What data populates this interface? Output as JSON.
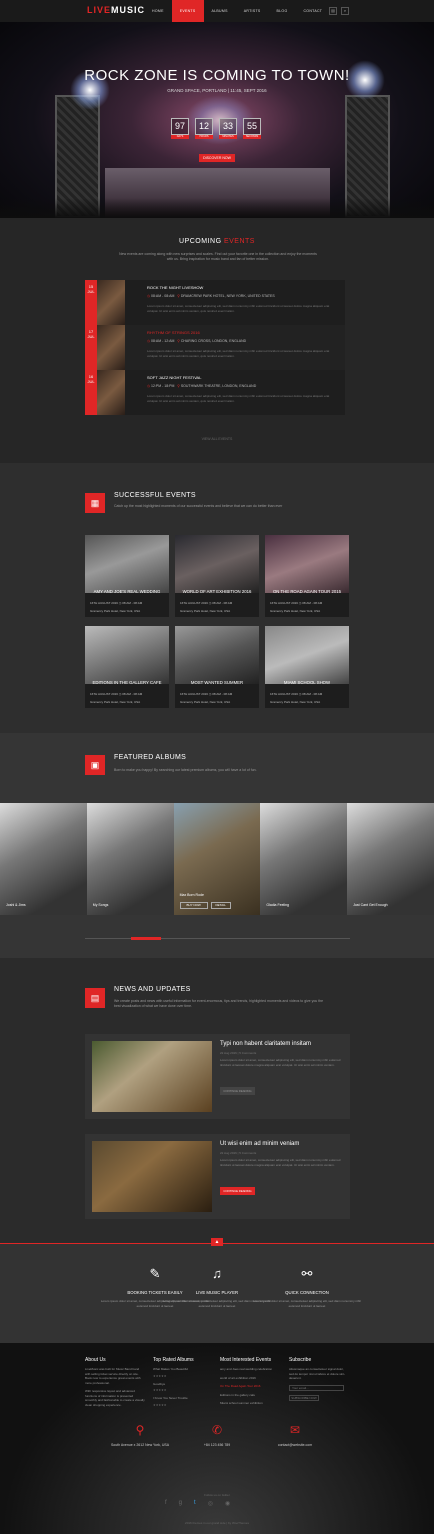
{
  "brand": {
    "logo_a": "LIVE",
    "logo_b": "MUSIC",
    "accent": "#e02626"
  },
  "nav": {
    "items": [
      "HOME",
      "EVENTS",
      "ALBUMS",
      "ARTISTS",
      "BLOG",
      "CONTACT"
    ],
    "active": 1
  },
  "hero": {
    "title": "ROCK ZONE IS COMING TO TOWN!",
    "subtitle": "GRAND SPACE, PORTLAND  |  11:45, SEPT 2016",
    "countdown": [
      {
        "n": "97",
        "l": "DAYS"
      },
      {
        "n": "12",
        "l": "HOURS"
      },
      {
        "n": "33",
        "l": "MINUTES"
      },
      {
        "n": "55",
        "l": "SECONDS"
      }
    ],
    "cta": "DISCOVER NOW"
  },
  "upcoming": {
    "title_a": "UPCOMING",
    "title_b": "EVENTS",
    "desc": "New events are coming along with new surprises and scales. Find out your favorite one in the collection and enjoy the moments with us. Bring inspiration for music band and fan of better mission.",
    "events": [
      {
        "day": "15",
        "mon": "JUL",
        "title": "ROCK THE NIGHT LIVESHOW",
        "time": "08:AM - 08:AM",
        "place": "DRAMCREW PARK HOTEL, NEW YORK, UNITED STATES",
        "red": false
      },
      {
        "day": "17",
        "mon": "JUL",
        "title": "RHYTHM OF STRINGS 2016",
        "time": "08:AM - 12:AM",
        "place": "CHARING CROSS, LONDON, ENGLAND",
        "red": true
      },
      {
        "day": "16",
        "mon": "JUL",
        "title": "SOFT JAZZ NIGHT FESTIVAL",
        "time": "12:PM - 18:PM",
        "place": "SOUTHWARK THEATRE, LONDON, ENGLAND",
        "red": false
      }
    ],
    "text": "Lorem ipsum dolor sit amet, consectetuer adipiscing elit, sed diam nonummy nibh euismod tincidunt ut laoreet dolore magna aliquam erat volutpat. Ut wisi enim ad minim veniam, quis nostrud exerci tation.",
    "more": "VIEW ALL EVENTS"
  },
  "success": {
    "title": "SUCCESSFUL EVENTS",
    "desc": "Catch up the most highlighted moments of our successful events and believe that we can do better than ever",
    "cards": [
      {
        "t": "AMY AND JOE'S REAL WEDDING",
        "d": "16TH AUGUST 2016",
        "h": "08:AM - 08:AM",
        "l": "Gramercy Park Hotel, New York, USA"
      },
      {
        "t": "WORLD OF ART EXHIBITION 2016",
        "d": "16TH AUGUST 2016",
        "h": "08:AM - 08:AM",
        "l": "Gramercy Park Hotel, New York, USA"
      },
      {
        "t": "ON THE ROAD AGAIN TOUR 2015",
        "d": "16TH AUGUST 2016",
        "h": "08:AM - 08:AM",
        "l": "Gramercy Park Hotel, New York, USA"
      },
      {
        "t": "EDITIONS IN THE GALLERY CAFE",
        "d": "16TH AUGUST 2016",
        "h": "08:AM - 08:AM",
        "l": "Gramercy Park Hotel, New York, USA"
      },
      {
        "t": "MOST WANTED SUMMER",
        "d": "16TH AUGUST 2016",
        "h": "08:AM - 08:AM",
        "l": "Gramercy Park Hotel, New York, USA"
      },
      {
        "t": "MIAMI SCHOOL SHOW",
        "d": "16TH AUGUST 2016",
        "h": "08:AM - 08:AM",
        "l": "Gramercy Park Hotel, New York, USA"
      }
    ]
  },
  "albums": {
    "title": "FEATURED ALBUMS",
    "desc": "Born to make you happy! By searching our latest premium albums, you will have a lot of fun.",
    "items": [
      "Joshi & Jims",
      "My Songs",
      "Max Born Rode",
      "Gladia Feeling",
      "Just Cant Get Enough"
    ],
    "buy": "BUY NOW",
    "detail": "DETAIL"
  },
  "news": {
    "title": "NEWS AND UPDATES",
    "desc": "We create posts and news with useful information for event-enormous, tips and trends, highlighted moments and videos to give you the best visualization of what we have done over time.",
    "posts": [
      {
        "t": "Typi non habent claritatem insitam",
        "d": "22 Aug 2016  |  5 Comments",
        "x": "Lorem ipsum dolor sit amet, consectetuer adipiscing elit, sed diam nonummy nibh euismod tincidunt ut laoreet dolore magna aliquam erat volutpat. Ut wisi enim ad minim veniam.",
        "b": "CONTINUE READING"
      },
      {
        "t": "Ut wisi enim ad minim veniam",
        "d": "22 Aug 2016  |  5 Comments",
        "x": "Lorem ipsum dolor sit amet, consectetuer adipiscing elit, sed diam nonummy nibh euismod tincidunt ut laoreet dolore magna aliquam erat volutpat. Ut wisi enim ad minim veniam.",
        "b": "CONTINUE READING"
      }
    ]
  },
  "features": [
    {
      "t": "BOOKING TICKETS EASILY",
      "d": "Lorem ipsum dolor sit amet, consectetuer adipiscing elit, sed diam nonummy nibh euismod tincidunt ut laoreet"
    },
    {
      "t": "LIVE MUSIC PLAYER",
      "d": "Lorem ipsum dolor sit amet, consectetuer adipiscing elit, sed diam nonummy nibh euismod tincidunt ut laoreet"
    },
    {
      "t": "QUICK CONNECTION",
      "d": "Lorem ipsum dolor sit amet, consectetuer adipiscing elit, sed diam nonummy nibh euismod tincidunt ut laoreet"
    }
  ],
  "footer": {
    "about": {
      "h": "About Us",
      "t": "LiveMusic was built for Music Band band with selling ticket service directly on site. Book now to experience great events with more professional.",
      "t2": "With responsive layout and advanced functions of information is presented smoothly and fashionable to create a visually clean shopping experience."
    },
    "top": {
      "h": "Top Rated Albums",
      "items": [
        "What Makes You Beautiful",
        "Goodbye",
        "I Know You Never Trouble"
      ]
    },
    "events": {
      "h": "Most Interested Events",
      "items": [
        "amy and Joes real wedding celebration",
        "world of art exhibition 2016",
        "On The Road Again Tour 2016",
        "Editions in the gallery cafe",
        "Miami school summer exhibition"
      ]
    },
    "sub": {
      "h": "Subscribe",
      "t": "Aliusmaque an consectetuer signal dolor, sed do tempor nisi ut labore et dolore sint-deserunt.",
      "ph": "Your email...",
      "btn": "SUBSCRIBE NOW"
    },
    "addr": "South Avenue x 2612 New York, USA",
    "phone": "+84 123 456 789",
    "mail": "contact@website.com",
    "follow": "Follow us on twitter",
    "copy": "2016 themes in our grand side | by WooThemes"
  }
}
